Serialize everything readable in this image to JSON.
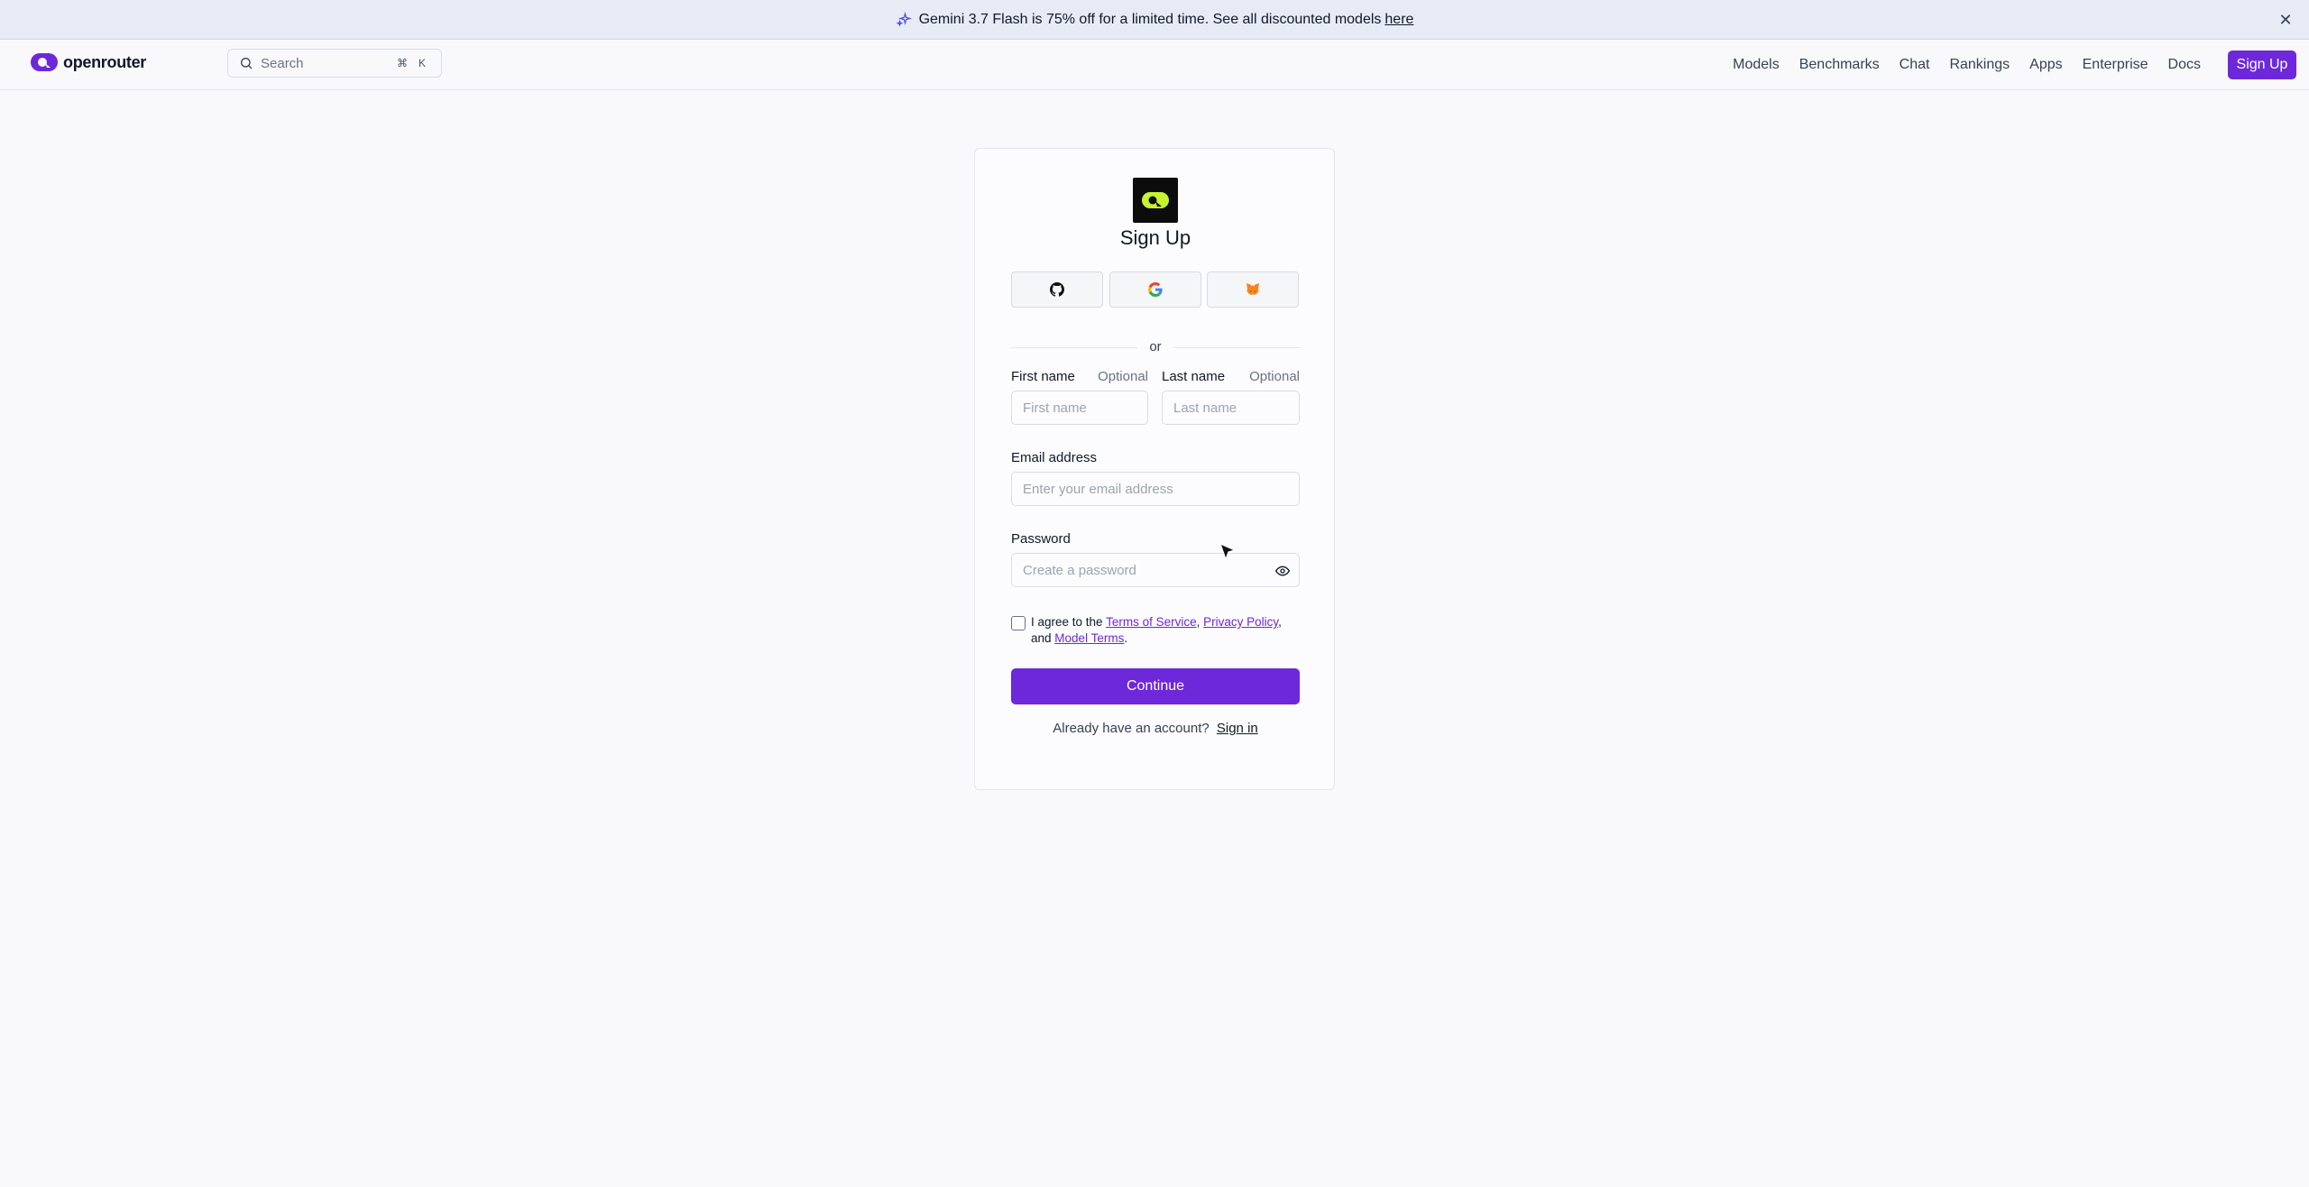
{
  "banner": {
    "text": "Gemini 3.7 Flash is 75% off for a limited time. See all discounted models",
    "link": "here",
    "close": "✕",
    "icon": "sparkle-icon"
  },
  "nav": {
    "brand": "openrouter",
    "search_placeholder": "Search",
    "shortcut_cmd": "⌘",
    "shortcut_key": "K",
    "links": [
      "Models",
      "Benchmarks",
      "Chat",
      "Rankings",
      "Apps",
      "Enterprise",
      "Docs"
    ],
    "signup": "Sign Up"
  },
  "form": {
    "title": "Sign Up",
    "oauth": [
      "github-icon",
      "google-icon",
      "metamask-icon"
    ],
    "divider": "or",
    "first_name_label": "First name",
    "first_name_optional": "Optional",
    "first_name_placeholder": "First name",
    "last_name_label": "Last name",
    "last_name_optional": "Optional",
    "last_name_placeholder": "Last name",
    "email_label": "Email address",
    "email_placeholder": "Enter your email address",
    "password_label": "Password",
    "password_placeholder": "Create a password",
    "terms_prefix": "I agree to the",
    "terms_of_service": "Terms of Service",
    "comma": ",",
    "privacy_policy": "Privacy Policy",
    "and": ", and",
    "model_terms": "Model Terms",
    "period": ".",
    "continue": "Continue",
    "already": "Already have an account?",
    "sign_in": "Sign in"
  },
  "colors": {
    "accent": "#6d28d9",
    "banner_bg": "#e6ebf5",
    "page_bg": "#f9f9fc"
  }
}
